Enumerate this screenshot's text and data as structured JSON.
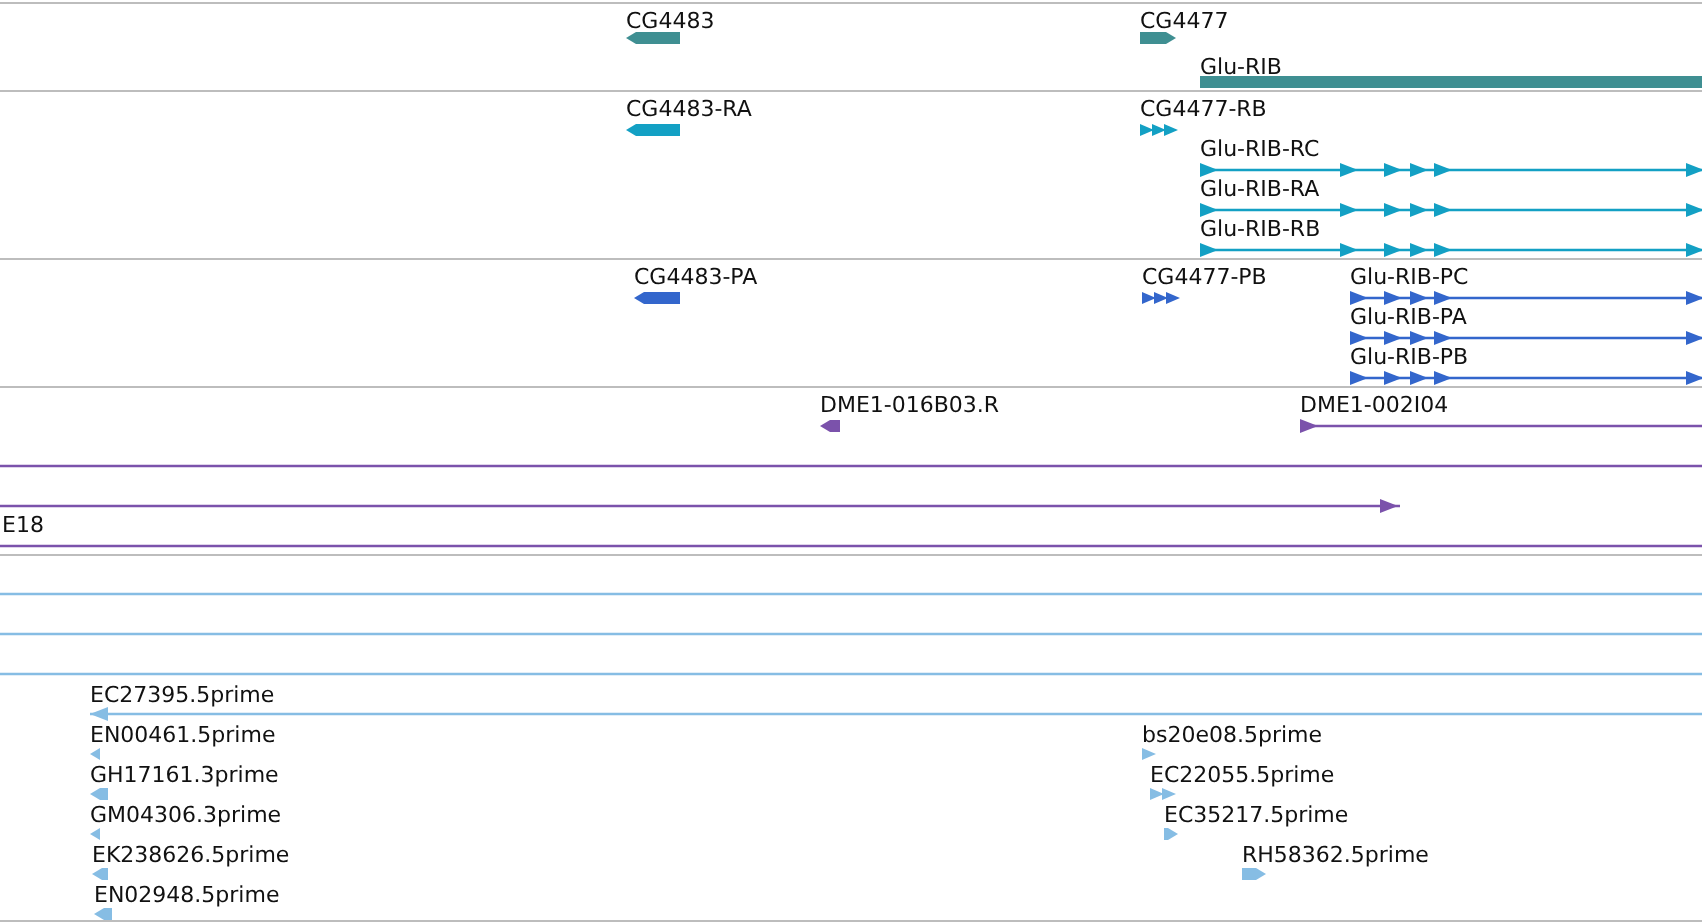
{
  "tracks": [
    {
      "color": "#3f8f92",
      "features": [
        {
          "label": "CG4483",
          "kind": "bar",
          "reverse": true
        },
        {
          "label": "CG4477",
          "kind": "bar",
          "reverse": false
        },
        {
          "label": "Glu-RIB",
          "kind": "bar"
        }
      ]
    },
    {
      "color": "#13a0c4",
      "features": [
        {
          "label": "CG4483-RA",
          "kind": "bar",
          "reverse": true
        },
        {
          "label": "CG4477-RB",
          "kind": "chevrons",
          "reverse": false
        },
        {
          "label": "Glu-RIB-RC",
          "kind": "transcript",
          "reverse": false
        },
        {
          "label": "Glu-RIB-RA",
          "kind": "transcript",
          "reverse": false
        },
        {
          "label": "Glu-RIB-RB",
          "kind": "transcript",
          "reverse": false
        }
      ]
    },
    {
      "color": "#3366cc",
      "features": [
        {
          "label": "CG4483-PA",
          "kind": "bar",
          "reverse": true
        },
        {
          "label": "CG4477-PB",
          "kind": "chevrons",
          "reverse": false
        },
        {
          "label": "Glu-RIB-PC",
          "kind": "transcript",
          "reverse": false
        },
        {
          "label": "Glu-RIB-PA",
          "kind": "transcript",
          "reverse": false
        },
        {
          "label": "Glu-RIB-PB",
          "kind": "transcript",
          "reverse": false
        }
      ]
    },
    {
      "color": "#7b52ab",
      "features": [
        {
          "label": "DME1-016B03.R",
          "kind": "bar",
          "reverse": true
        },
        {
          "label": "DME1-002I04",
          "kind": "transcript",
          "reverse": false
        },
        {
          "kind": "line"
        },
        {
          "kind": "transcript",
          "reverse": false
        },
        {
          "label": "E18",
          "kind": "line"
        }
      ]
    },
    {
      "color": "#86bde4",
      "features": [
        {
          "kind": "line"
        },
        {
          "kind": "line"
        },
        {
          "kind": "line"
        },
        {
          "label": "EC27395.5prime",
          "kind": "transcript",
          "reverse": true
        },
        {
          "label": "EN00461.5prime",
          "kind": "bar",
          "reverse": true
        },
        {
          "label": "GH17161.3prime",
          "kind": "bar",
          "reverse": true
        },
        {
          "label": "GM04306.3prime",
          "kind": "bar",
          "reverse": true
        },
        {
          "label": "EK238626.5prime",
          "kind": "bar",
          "reverse": true
        },
        {
          "label": "EN02948.5prime",
          "kind": "bar",
          "reverse": true
        },
        {
          "label": "bs20e08.5prime",
          "kind": "chevrons",
          "reverse": false
        },
        {
          "label": "EC22055.5prime",
          "kind": "chevrons",
          "reverse": false
        },
        {
          "label": "EC35217.5prime",
          "kind": "bar",
          "reverse": false
        },
        {
          "label": "RH58362.5prime",
          "kind": "bar",
          "reverse": false
        }
      ]
    }
  ]
}
